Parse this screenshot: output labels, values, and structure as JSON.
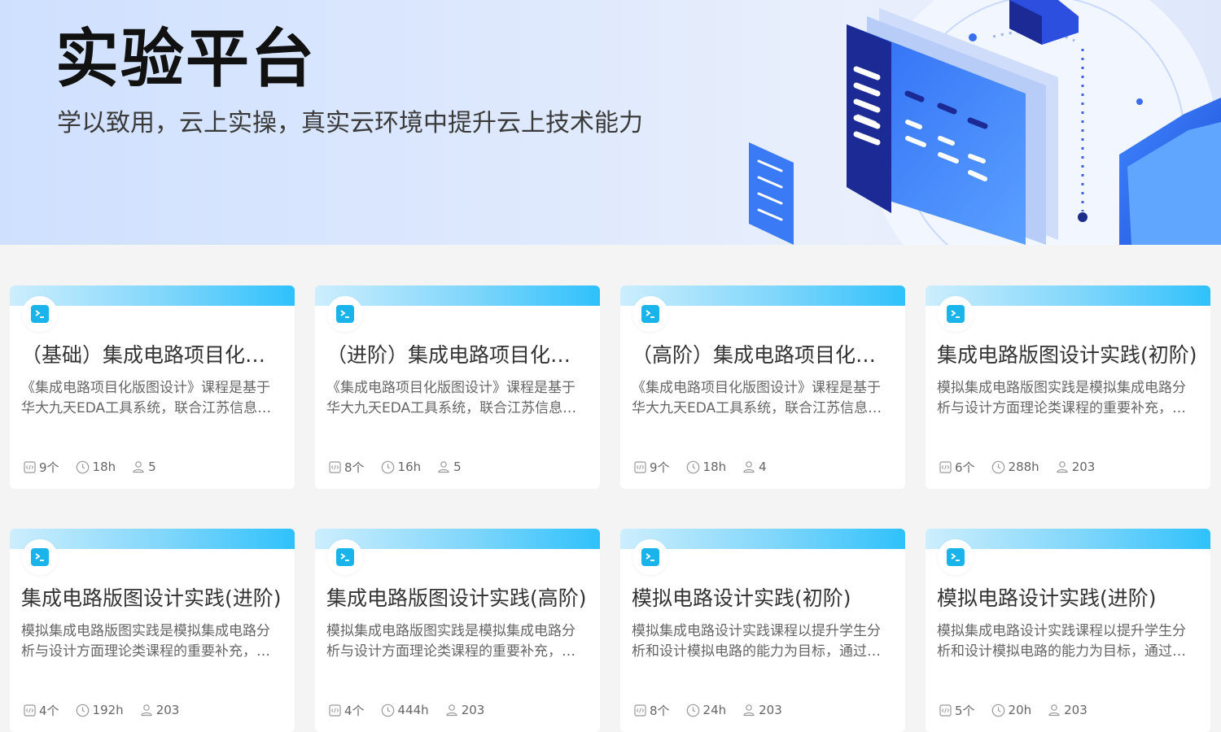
{
  "banner": {
    "title": "实验平台",
    "subtitle": "学以致用，云上实操，真实云环境中提升云上技术能力"
  },
  "colors": {
    "accent": "#1ab3ea",
    "band_start": "#cdeefd",
    "band_end": "#2fc1fb",
    "banner_bg": "#dde8fd"
  },
  "icons": [
    "terminal-icon",
    "code-icon",
    "clock-icon",
    "user-icon"
  ],
  "cards": [
    {
      "title": "（基础）集成电路项目化版图设计",
      "desc": "《集成电路项目化版图设计》课程是基于华大九天EDA工具系统，联合江苏信息职业技术学院",
      "experiments": "9个",
      "hours": "18h",
      "learners": "5"
    },
    {
      "title": "（进阶）集成电路项目化版图设计",
      "desc": "《集成电路项目化版图设计》课程是基于华大九天EDA工具系统，联合江苏信息职业技术学院",
      "experiments": "8个",
      "hours": "16h",
      "learners": "5"
    },
    {
      "title": "（高阶）集成电路项目化版图设计",
      "desc": "《集成电路项目化版图设计》课程是基于华大九天EDA工具系统，联合江苏信息职业技术学院",
      "experiments": "9个",
      "hours": "18h",
      "learners": "4"
    },
    {
      "title": "集成电路版图设计实践(初阶)",
      "desc": "模拟集成电路版图实践是模拟集成电路分析与设计方面理论类课程的重要补充，旨在培养学生",
      "experiments": "6个",
      "hours": "288h",
      "learners": "203"
    },
    {
      "title": "集成电路版图设计实践(进阶)",
      "desc": "模拟集成电路版图实践是模拟集成电路分析与设计方面理论类课程的重要补充，旨在培养学生",
      "experiments": "4个",
      "hours": "192h",
      "learners": "203"
    },
    {
      "title": "集成电路版图设计实践(高阶)",
      "desc": "模拟集成电路版图实践是模拟集成电路分析与设计方面理论类课程的重要补充，旨在培养学生",
      "experiments": "4个",
      "hours": "444h",
      "learners": "203"
    },
    {
      "title": "模拟电路设计实践(初阶)",
      "desc": "模拟集成电路设计实践课程以提升学生分析和设计模拟电路的能力为目标，通过项目实践",
      "experiments": "8个",
      "hours": "24h",
      "learners": "203"
    },
    {
      "title": "模拟电路设计实践(进阶)",
      "desc": "模拟集成电路设计实践课程以提升学生分析和设计模拟电路的能力为目标，通过项目实践",
      "experiments": "5个",
      "hours": "20h",
      "learners": "203"
    }
  ]
}
